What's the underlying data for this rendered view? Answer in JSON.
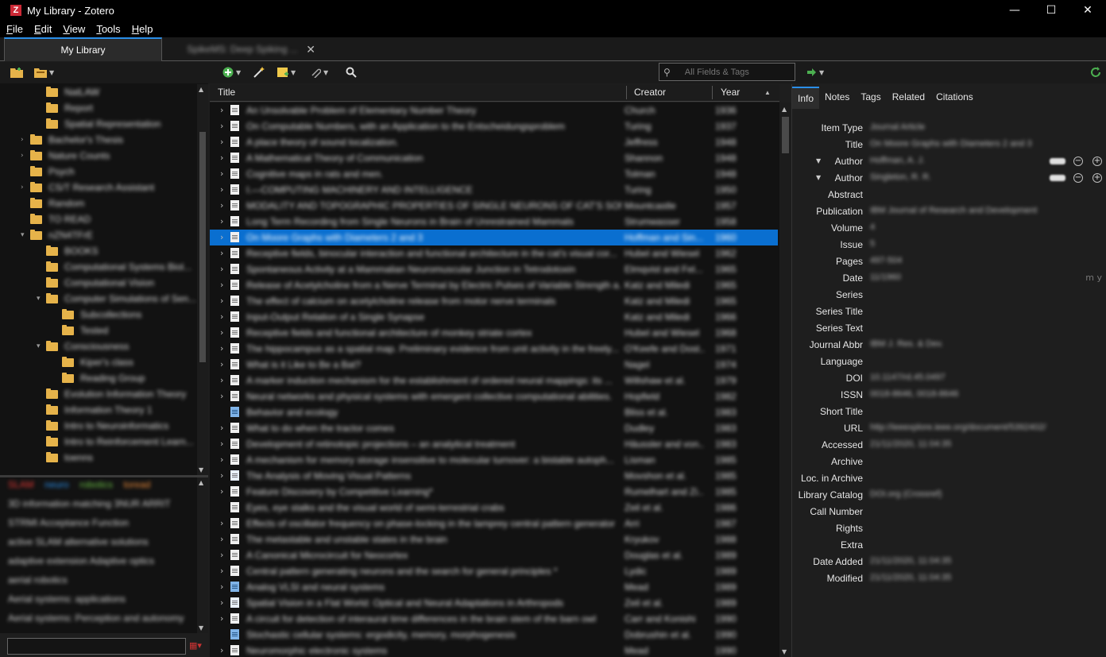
{
  "window": {
    "title": "My Library - Zotero",
    "icon_letter": "Z"
  },
  "menu": [
    "File",
    "Edit",
    "View",
    "Tools",
    "Help"
  ],
  "tabs": {
    "active": "My Library",
    "second": "SpikeMS: Deep Spiking ..."
  },
  "toolbar": {
    "search_placeholder": "All Fields & Tags"
  },
  "collections": [
    "NatLAW",
    "Report",
    "Spatial Representation",
    "Bachelor's Thesis",
    "Nature Counts",
    "Psych",
    "CS/T Research Assistant",
    "Random",
    "TO READ",
    "nZN4TFrE",
    "BOOKS",
    "Computational Systems Biol...",
    "Computational Vision",
    "Computer Simulations of Sen...",
    "Subcollections",
    "Tested",
    "Consciousness",
    "Kiper's class",
    "Reading Group",
    "Evolution Information Theory",
    "Information Theory 1",
    "Intro to Neuroinformatics",
    "Intro to Reinforcement Learn...",
    "toenns"
  ],
  "tags": {
    "colored": [
      "SLAM",
      "neuro",
      "robotics",
      "toread"
    ],
    "lines": [
      "3D information matching   3NUR   ARRIT",
      "STRMI   Acceptance Function",
      "active SLAM alternative solutions",
      "adaptive extension   Adaptive optics",
      "aerial robotics",
      "Aerial systems: applications",
      "Aerial systems: Perception and autonomy"
    ]
  },
  "items_header": {
    "title": "Title",
    "creator": "Creator",
    "year": "Year"
  },
  "items": [
    {
      "title": "An Unsolvable Problem of Elementary Number Theory",
      "creator": "Church",
      "year": "1936",
      "icon": "doc",
      "twisty": true
    },
    {
      "title": "On Computable Numbers, with an Application to the Entscheidungsproblem",
      "creator": "Turing",
      "year": "1937",
      "icon": "doc",
      "twisty": true
    },
    {
      "title": "A place theory of sound localization.",
      "creator": "Jeffress",
      "year": "1948",
      "icon": "doc",
      "twisty": true
    },
    {
      "title": "A Mathematical Theory of Communication",
      "creator": "Shannon",
      "year": "1948",
      "icon": "doc",
      "twisty": true
    },
    {
      "title": "Cognitive maps in rats and men.",
      "creator": "Tolman",
      "year": "1948",
      "icon": "doc",
      "twisty": true
    },
    {
      "title": "I.—COMPUTING MACHINERY AND INTELLIGENCE",
      "creator": "Turing",
      "year": "1950",
      "icon": "doc",
      "twisty": true
    },
    {
      "title": "MODALITY AND TOPOGRAPHIC PROPERTIES OF SINGLE NEURONS OF CAT'S SOMATIC ...",
      "creator": "Mountcastle",
      "year": "1957",
      "icon": "doc",
      "twisty": true
    },
    {
      "title": "Long Term Recording from Single Neurons in Brain of Unrestrained Mammals",
      "creator": "Strumwasser",
      "year": "1958",
      "icon": "doc",
      "twisty": true
    },
    {
      "title": "On Moore Graphs with Diameters 2 and 3",
      "creator": "Hoffman and Sin...",
      "year": "1960",
      "icon": "doc",
      "twisty": true,
      "selected": true
    },
    {
      "title": "Receptive fields, binocular interaction and functional architecture in the cat's visual cor...",
      "creator": "Hubel and Wiesel",
      "year": "1962",
      "icon": "doc",
      "twisty": true
    },
    {
      "title": "Spontaneous Activity at a Mammalian Neuromuscular Junction in Tetrodotoxin",
      "creator": "Elmqvist and Fel...",
      "year": "1965",
      "icon": "doc",
      "twisty": true
    },
    {
      "title": "Release of Acetylcholine from a Nerve Terminal by Electric Pulses of Variable Strength a...",
      "creator": "Katz and Miledi",
      "year": "1965",
      "icon": "doc",
      "twisty": true
    },
    {
      "title": "The effect of calcium on acetylcholine release from motor nerve terminals",
      "creator": "Katz and Miledi",
      "year": "1965",
      "icon": "doc",
      "twisty": true
    },
    {
      "title": "Input-Output Relation of a Single Synapse",
      "creator": "Katz and Miledi",
      "year": "1966",
      "icon": "doc",
      "twisty": true
    },
    {
      "title": "Receptive fields and functional architecture of monkey striate cortex",
      "creator": "Hubel and Wiesel",
      "year": "1968",
      "icon": "doc",
      "twisty": true
    },
    {
      "title": "The hippocampus as a spatial map. Preliminary evidence from unit activity in the freely...",
      "creator": "O'Keefe and Dost...",
      "year": "1971",
      "icon": "doc",
      "twisty": true
    },
    {
      "title": "What is it Like to Be a Bat?",
      "creator": "Nagel",
      "year": "1974",
      "icon": "doc",
      "twisty": true
    },
    {
      "title": "A marker induction mechanism for the establishment of ordered neural mappings: its ...",
      "creator": "Willshaw et al.",
      "year": "1979",
      "icon": "doc",
      "twisty": true
    },
    {
      "title": "Neural networks and physical systems with emergent collective computational abilities.",
      "creator": "Hopfield",
      "year": "1982",
      "icon": "doc",
      "twisty": true
    },
    {
      "title": "Behavior and ecology",
      "creator": "Bliss et al.",
      "year": "1983",
      "icon": "book",
      "twisty": false
    },
    {
      "title": "What to do when the tractor comes",
      "creator": "Dudley",
      "year": "1983",
      "icon": "doc",
      "twisty": true
    },
    {
      "title": "Development of retinotopic projections – an analytical treatment",
      "creator": "Häussler and von...",
      "year": "1983",
      "icon": "doc",
      "twisty": true
    },
    {
      "title": "A mechanism for memory storage insensitive to molecular turnover: a bistable autoph...",
      "creator": "Lisman",
      "year": "1985",
      "icon": "doc",
      "twisty": true
    },
    {
      "title": "The Analysis of Moving Visual Patterns",
      "creator": "Movshon et al.",
      "year": "1985",
      "icon": "open",
      "twisty": true
    },
    {
      "title": "Feature Discovery by Competitive Learning*",
      "creator": "Rumelhart and Zi...",
      "year": "1985",
      "icon": "doc",
      "twisty": true
    },
    {
      "title": "Eyes, eye stalks and the visual world of semi-terrestrial crabs",
      "creator": "Zeil et al.",
      "year": "1986",
      "icon": "doc",
      "twisty": false
    },
    {
      "title": "Effects of oscillator frequency on phase-locking in the lamprey central pattern generator",
      "creator": "Arri",
      "year": "1987",
      "icon": "doc",
      "twisty": true
    },
    {
      "title": "The metastable and unstable states in the brain",
      "creator": "Kryukov",
      "year": "1988",
      "icon": "doc",
      "twisty": true
    },
    {
      "title": "A Canonical Microcircuit for Neocortex",
      "creator": "Douglas et al.",
      "year": "1989",
      "icon": "doc",
      "twisty": true
    },
    {
      "title": "Central pattern generating neurons and the search for general principles *",
      "creator": "Lydic",
      "year": "1989",
      "icon": "doc",
      "twisty": true
    },
    {
      "title": "Analog VLSI and neural systems",
      "creator": "Mead",
      "year": "1989",
      "icon": "book",
      "twisty": true
    },
    {
      "title": "Spatial Vision in a Flat World: Optical and Neural Adaptations in Arthropods",
      "creator": "Zeil et al.",
      "year": "1989",
      "icon": "open",
      "twisty": true
    },
    {
      "title": "A circuit for detection of interaural time differences in the brain stem of the barn owl",
      "creator": "Carr and Konishi",
      "year": "1990",
      "icon": "doc",
      "twisty": true
    },
    {
      "title": "Stochastic cellular systems: ergodicity, memory, morphogenesis",
      "creator": "Dobrushin et al.",
      "year": "1990",
      "icon": "book",
      "twisty": false
    },
    {
      "title": "Neuromorphic electronic systems",
      "creator": "Mead",
      "year": "1990",
      "icon": "doc",
      "twisty": true
    }
  ],
  "item_pane": {
    "tabs": [
      "Info",
      "Notes",
      "Tags",
      "Related",
      "Citations"
    ],
    "fields": [
      {
        "label": "Item Type",
        "value": "Journal Article"
      },
      {
        "label": "Title",
        "value": "On Moore Graphs with Diameters 2 and 3"
      },
      {
        "label": "Author",
        "value": "Hoffman, A. J.",
        "creator": true
      },
      {
        "label": "Author",
        "value": "Singleton, R. R.",
        "creator": true
      },
      {
        "label": "Abstract",
        "value": ""
      },
      {
        "label": "Publication",
        "value": "IBM Journal of Research and Development"
      },
      {
        "label": "Volume",
        "value": "4"
      },
      {
        "label": "Issue",
        "value": "5"
      },
      {
        "label": "Pages",
        "value": "497-504"
      },
      {
        "label": "Date",
        "value": "11/1960",
        "hint": "m y"
      },
      {
        "label": "Series",
        "value": ""
      },
      {
        "label": "Series Title",
        "value": ""
      },
      {
        "label": "Series Text",
        "value": ""
      },
      {
        "label": "Journal Abbr",
        "value": "IBM J. Res. & Dev."
      },
      {
        "label": "Language",
        "value": ""
      },
      {
        "label": "DOI",
        "value": "10.1147/rd.45.0497"
      },
      {
        "label": "ISSN",
        "value": "0018-8646, 0018-8646"
      },
      {
        "label": "Short Title",
        "value": ""
      },
      {
        "label": "URL",
        "value": "http://ieeexplore.ieee.org/document/5392402/"
      },
      {
        "label": "Accessed",
        "value": "21/11/2020, 11:04:35"
      },
      {
        "label": "Archive",
        "value": ""
      },
      {
        "label": "Loc. in Archive",
        "value": ""
      },
      {
        "label": "Library Catalog",
        "value": "DOI.org (Crossref)"
      },
      {
        "label": "Call Number",
        "value": ""
      },
      {
        "label": "Rights",
        "value": ""
      },
      {
        "label": "Extra",
        "value": ""
      },
      {
        "label": "Date Added",
        "value": "21/11/2020, 11:04:35"
      },
      {
        "label": "Modified",
        "value": "21/11/2020, 11:04:35"
      }
    ]
  }
}
